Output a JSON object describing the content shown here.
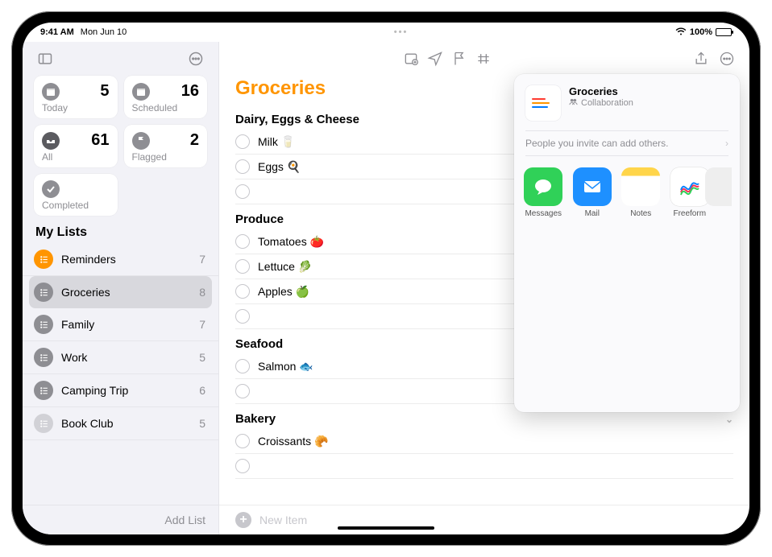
{
  "status": {
    "time": "9:41 AM",
    "date": "Mon Jun 10",
    "battery_pct": "100%"
  },
  "sidebar": {
    "smart": {
      "today": {
        "label": "Today",
        "count": 5
      },
      "scheduled": {
        "label": "Scheduled",
        "count": 16
      },
      "all": {
        "label": "All",
        "count": 61
      },
      "flagged": {
        "label": "Flagged",
        "count": 2
      },
      "completed": {
        "label": "Completed"
      }
    },
    "mylists_header": "My Lists",
    "items": [
      {
        "name": "Reminders",
        "count": 7,
        "color": "#ff9500"
      },
      {
        "name": "Groceries",
        "count": 8,
        "color": "#8e8e93"
      },
      {
        "name": "Family",
        "count": 7,
        "color": "#8e8e93"
      },
      {
        "name": "Work",
        "count": 5,
        "color": "#8e8e93"
      },
      {
        "name": "Camping Trip",
        "count": 6,
        "color": "#8e8e93"
      },
      {
        "name": "Book Club",
        "count": 5,
        "color": "#d1d1d6"
      }
    ],
    "add_list": "Add List"
  },
  "list": {
    "title": "Groceries",
    "title_color": "#ff9500",
    "sections": [
      {
        "header": "Dairy, Eggs & Cheese",
        "items": [
          {
            "title": "Milk 🥛"
          },
          {
            "title": "Eggs 🍳"
          }
        ]
      },
      {
        "header": "Produce",
        "items": [
          {
            "title": "Tomatoes 🍅"
          },
          {
            "title": "Lettuce 🥬"
          },
          {
            "title": "Apples 🍏"
          }
        ]
      },
      {
        "header": "Seafood",
        "items": [
          {
            "title": "Salmon 🐟"
          }
        ]
      },
      {
        "header": "Bakery",
        "collapsible": true,
        "items": [
          {
            "title": "Croissants 🥐"
          }
        ]
      }
    ],
    "new_item": "New Item"
  },
  "share": {
    "title": "Groceries",
    "subtitle": "Collaboration",
    "note": "People you invite can add others.",
    "apps": [
      {
        "label": "Messages",
        "color": "#30d158",
        "kind": "bubble"
      },
      {
        "label": "Mail",
        "color": "#1e90ff",
        "kind": "envelope"
      },
      {
        "label": "Notes",
        "color": "#f7f7f2",
        "kind": "notes"
      },
      {
        "label": "Freeform",
        "color": "#ffffff",
        "kind": "freeform"
      }
    ]
  }
}
